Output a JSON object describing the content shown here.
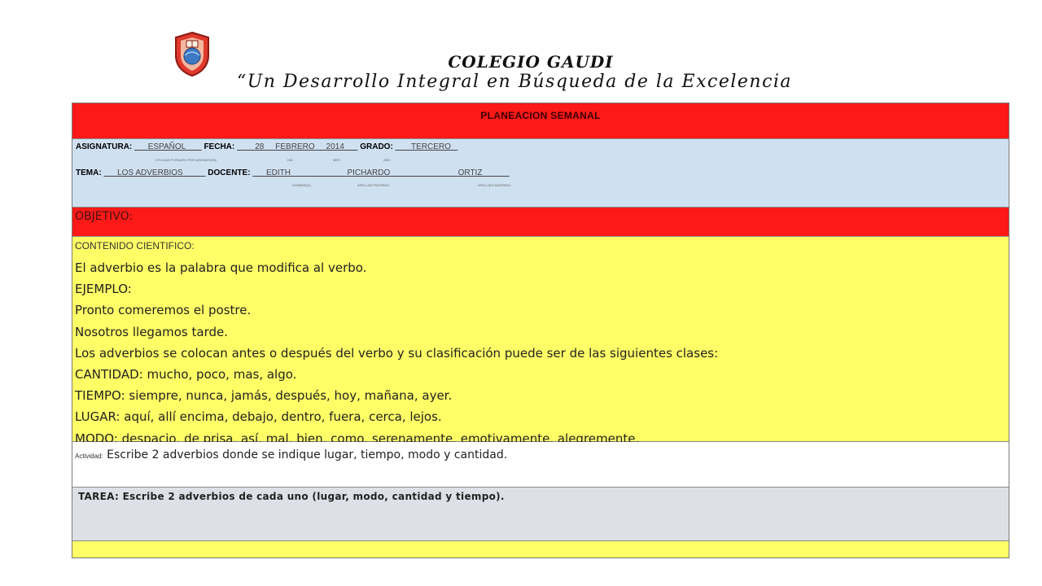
{
  "header": {
    "school_name": "COLEGIO GAUDI",
    "motto": "“Un Desarrollo Integral en Búsqueda de la Excelencia"
  },
  "planner": {
    "title": "PLANEACION SEMANAL",
    "asignatura_label": "ASIGNATURA:",
    "asignatura_value": "ESPAÑOL",
    "fecha_label": "FECHA:",
    "fecha_day": "28",
    "fecha_month": "FEBRERO",
    "fecha_year": "2014",
    "grado_label": "GRADO:",
    "grado_value": "TERCERO",
    "sub_asignatura": "UTILIZAR FORMATO POR ASIGNATURA",
    "sub_dia": "DÍA",
    "sub_mes": "MES",
    "sub_ano": "AÑO",
    "tema_label": "TEMA:",
    "tema_value": "LOS ADVERBIOS",
    "docente_label": "DOCENTE:",
    "docente_nombre": "EDITH",
    "docente_paterno": "PICHARDO",
    "docente_materno": "ORTIZ",
    "sub_nombre": "NOMBRE(S)",
    "sub_paterno": "APELLIDO PATERNO",
    "sub_materno": "APELLIDO MATERNO",
    "objetivo_label": "OBJETIVO:",
    "contenido_label": "CONTENIDO CIENTIFICO:",
    "contenido_lines": [
      "El adverbio es la palabra que modifica al verbo.",
      "EJEMPLO:",
      "Pronto comeremos el postre.",
      "Nosotros llegamos tarde.",
      "Los adverbios se colocan antes o después del verbo y su clasificación puede ser de las siguientes clases:",
      "CANTIDAD: mucho, poco, mas, algo.",
      "TIEMPO: siempre, nunca, jamás, después, hoy, mañana, ayer.",
      "LUGAR: aquí, allí encima, debajo, dentro, fuera, cerca, lejos.",
      "MODO: despacio, de prisa, así, mal, bien, como, serenamente, emotivamente, alegremente."
    ],
    "actividad_label": "Actividad:",
    "actividad_text": "Escribe 2 adverbios donde se indique lugar, tiempo, modo y cantidad.",
    "tarea_text": "TAREA: Escribe 2 adverbios de cada uno (lugar, modo, cantidad y tiempo)."
  },
  "colors": {
    "red": "#fe1919",
    "blue": "#cfe0f1",
    "yellow": "#fffe66",
    "grey": "#dde0e6"
  },
  "icons": {
    "logo": "school-crest-logo"
  }
}
